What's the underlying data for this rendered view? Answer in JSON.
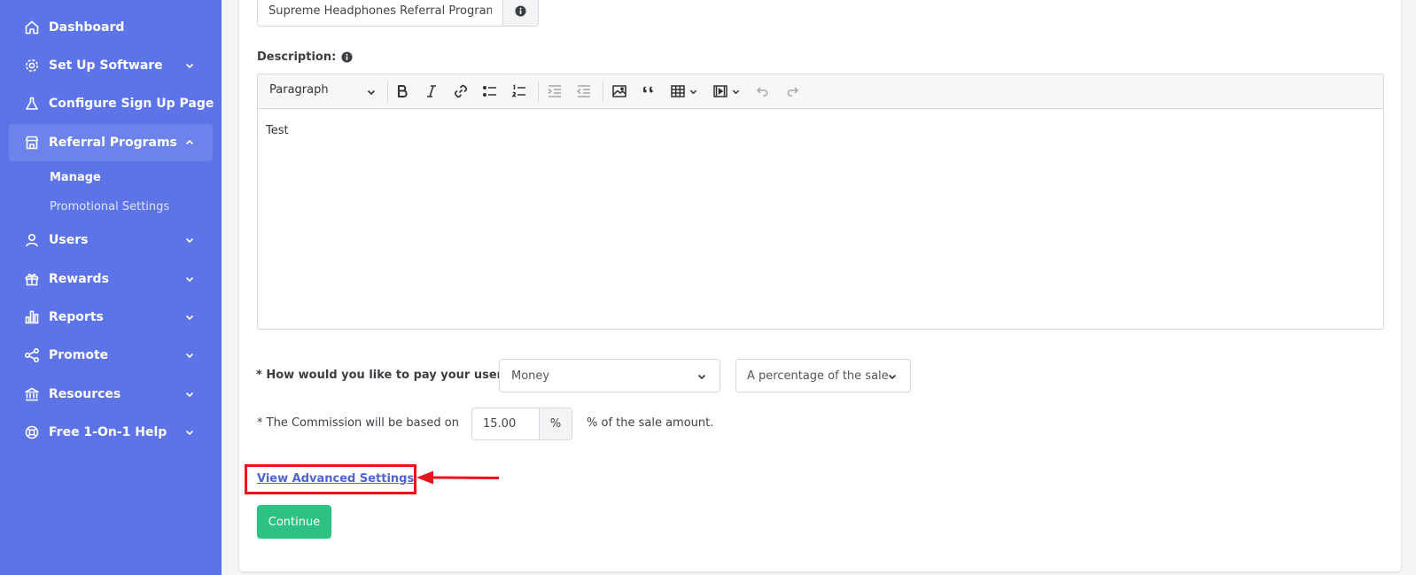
{
  "sidebar": {
    "items": [
      {
        "label": "Dashboard",
        "icon": "home-icon"
      },
      {
        "label": "Set Up Software",
        "icon": "gear-icon"
      },
      {
        "label": "Configure Sign Up Page",
        "icon": "flask-icon"
      },
      {
        "label": "Referral Programs",
        "icon": "store-icon"
      },
      {
        "label": "Users",
        "icon": "user-icon"
      },
      {
        "label": "Rewards",
        "icon": "gift-icon"
      },
      {
        "label": "Reports",
        "icon": "bar-chart-icon"
      },
      {
        "label": "Promote",
        "icon": "share-icon"
      },
      {
        "label": "Resources",
        "icon": "bank-icon"
      },
      {
        "label": "Free 1-On-1 Help",
        "icon": "lifebuoy-icon"
      }
    ],
    "subitems": [
      {
        "label": "Manage"
      },
      {
        "label": "Promotional Settings"
      }
    ]
  },
  "form": {
    "program_name": "Supreme Headphones Referral Program",
    "description_label": "Description:",
    "editor": {
      "block_format": "Paragraph",
      "content": "Test"
    },
    "pay_label": "* How would you like to pay your users:",
    "pay_method": "Money",
    "pay_type": "A percentage of the sale",
    "commission_label": "* The Commission will be based on",
    "commission_value": "15.00",
    "commission_unit": "%",
    "commission_suffix": "% of the sale amount.",
    "advanced_link": "View Advanced Settings",
    "continue_label": "Continue"
  },
  "colors": {
    "sidebar_bg": "#5c74e8",
    "sidebar_active": "#6d83ec",
    "primary_button": "#2fc084",
    "link": "#4f64d4",
    "annotation": "#e8141c"
  }
}
